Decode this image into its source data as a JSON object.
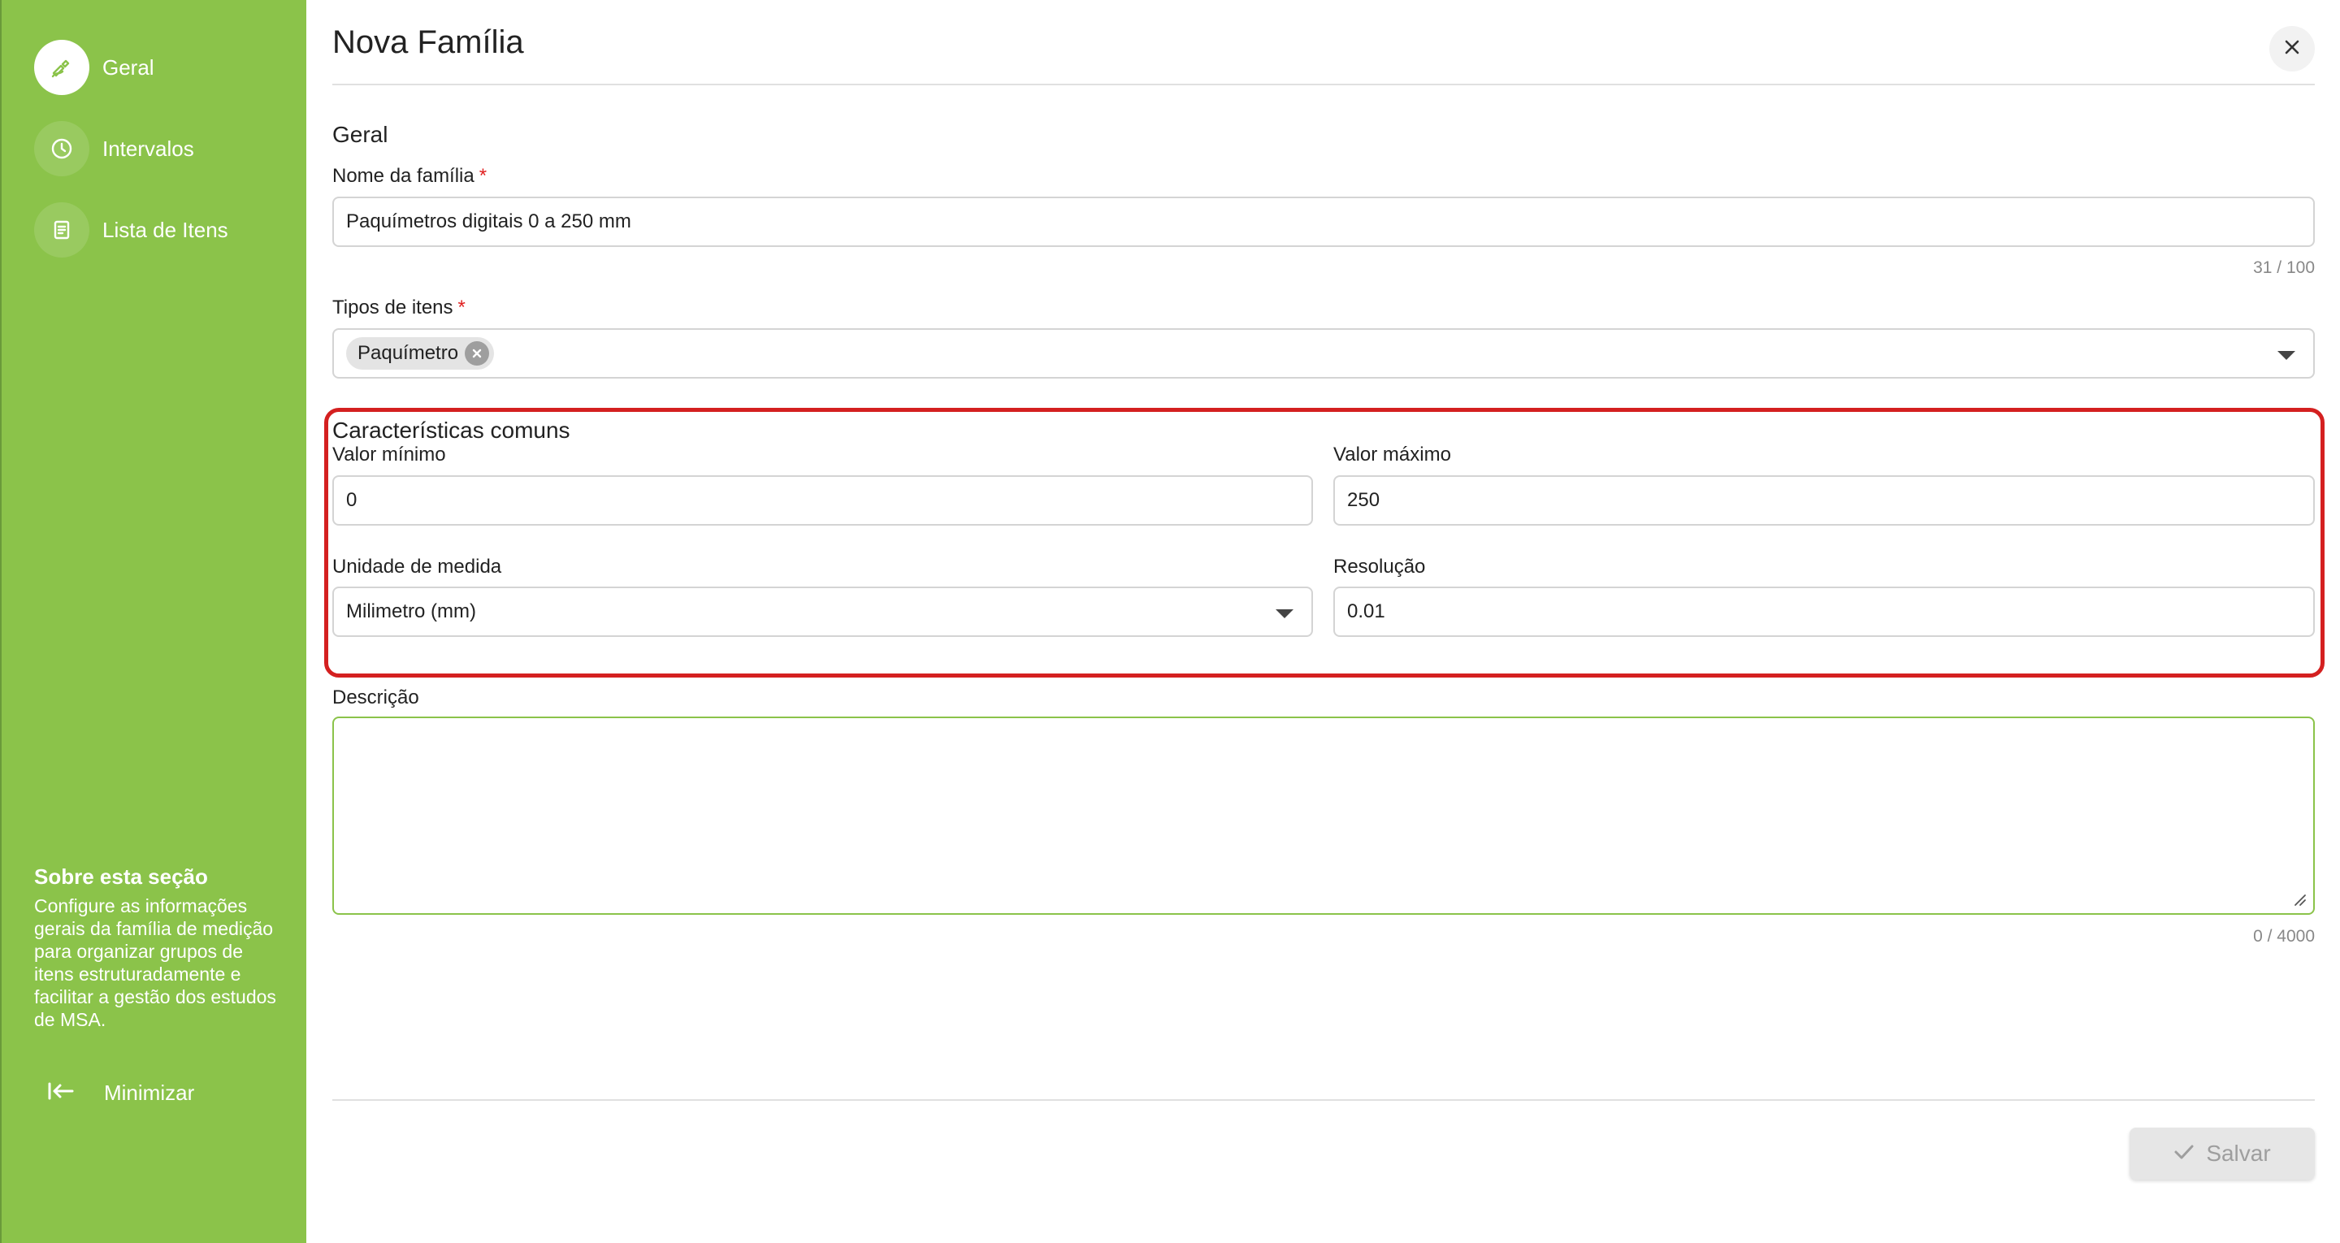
{
  "sidebar": {
    "items": [
      {
        "label": "Geral",
        "icon": "edit-icon",
        "active": true
      },
      {
        "label": "Intervalos",
        "icon": "clock-icon",
        "active": false
      },
      {
        "label": "Lista de Itens",
        "icon": "list-icon",
        "active": false
      }
    ],
    "about_title": "Sobre esta seção",
    "about_text": "Configure as informações gerais da família de medição para organizar grupos de itens estruturadamente e facilitar a gestão dos estudos de MSA.",
    "minimize_label": "Minimizar"
  },
  "header": {
    "title": "Nova Família",
    "close_icon": "close-icon"
  },
  "form": {
    "section_title": "Geral",
    "family_name": {
      "label": "Nome da família",
      "required": "*",
      "value": "Paquímetros digitais 0 a 250 mm",
      "counter": "31 / 100"
    },
    "item_types": {
      "label": "Tipos de itens",
      "required": "*",
      "chips": [
        "Paquímetro"
      ]
    },
    "common": {
      "title": "Características comuns",
      "min_label": "Valor mínimo",
      "min_value": "0",
      "max_label": "Valor máximo",
      "max_value": "250",
      "unit_label": "Unidade de medida",
      "unit_value": "Milimetro (mm)",
      "resolution_label": "Resolução",
      "resolution_value": "0.01"
    },
    "description": {
      "label": "Descrição",
      "value": "",
      "counter": "0 / 4000"
    }
  },
  "footer": {
    "save_label": "Salvar"
  },
  "colors": {
    "sidebar_green": "#8bc34a",
    "highlight_red": "#d42020",
    "required_red": "#e02020"
  }
}
